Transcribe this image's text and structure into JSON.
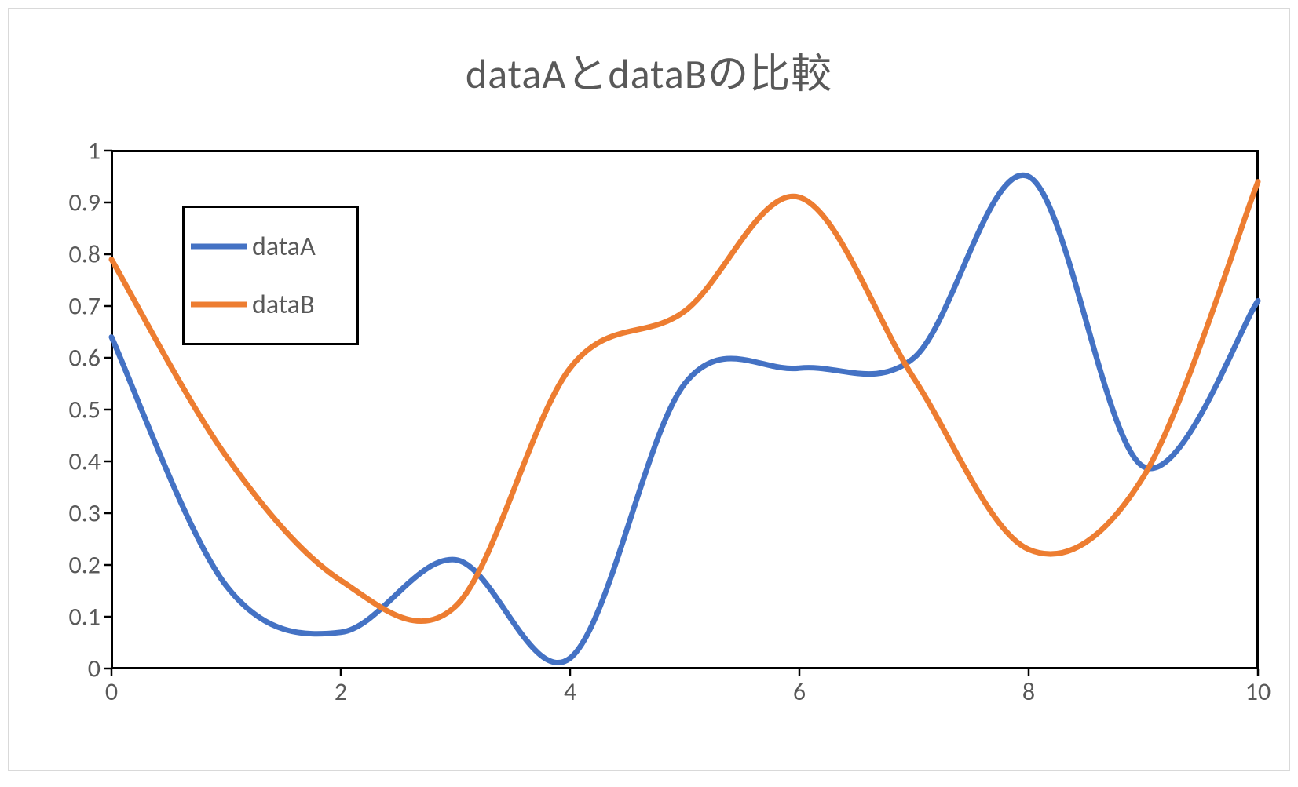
{
  "chart_data": {
    "type": "line",
    "title": "dataAとdataBの比較",
    "xlabel": "",
    "ylabel": "",
    "xlim": [
      0,
      10
    ],
    "ylim": [
      0,
      1
    ],
    "xticks": [
      0,
      2,
      4,
      6,
      8,
      10
    ],
    "yticks": [
      0,
      0.1,
      0.2,
      0.3,
      0.4,
      0.5,
      0.6,
      0.7,
      0.8,
      0.9,
      1
    ],
    "xtick_labels": [
      "0",
      "2",
      "4",
      "6",
      "8",
      "10"
    ],
    "ytick_labels": [
      "0",
      "0.1",
      "0.2",
      "0.3",
      "0.4",
      "0.5",
      "0.6",
      "0.7",
      "0.8",
      "0.9",
      "1"
    ],
    "legend_position": "upper-left-inside",
    "series": [
      {
        "name": "dataA",
        "color": "#4472C4",
        "x": [
          0,
          1,
          2,
          3,
          4,
          5,
          6,
          7,
          8,
          9,
          10
        ],
        "values": [
          0.64,
          0.16,
          0.07,
          0.21,
          0.02,
          0.55,
          0.58,
          0.6,
          0.95,
          0.39,
          0.71
        ]
      },
      {
        "name": "dataB",
        "color": "#ED7D31",
        "x": [
          0,
          1,
          2,
          3,
          4,
          5,
          6,
          7,
          8,
          9,
          10
        ],
        "values": [
          0.79,
          0.41,
          0.17,
          0.12,
          0.58,
          0.69,
          0.91,
          0.56,
          0.23,
          0.37,
          0.94
        ]
      }
    ]
  }
}
